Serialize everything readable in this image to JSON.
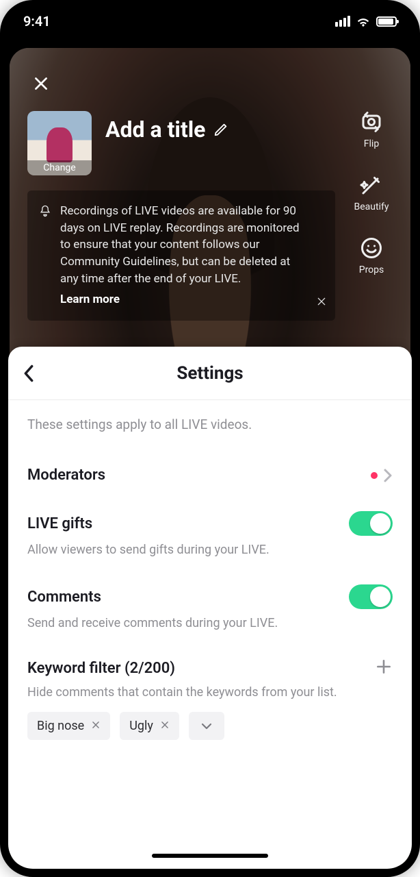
{
  "status": {
    "time": "9:41"
  },
  "camera": {
    "thumb_label": "Change",
    "title_placeholder": "Add a title",
    "info_text": "Recordings of LIVE videos are available for 90 days on LIVE replay. Recordings are monitored to ensure that your content follows our Community Guidelines, but can be deleted at any time after the end of your LIVE.",
    "info_learn_more": "Learn more",
    "tools": {
      "flip": "Flip",
      "beautify": "Beautify",
      "props": "Props"
    }
  },
  "sheet": {
    "title": "Settings",
    "hint": "These settings apply to all LIVE videos.",
    "moderators": {
      "label": "Moderators"
    },
    "gifts": {
      "label": "LIVE gifts",
      "desc": "Allow viewers to send gifts during your LIVE.",
      "on": true
    },
    "comments": {
      "label": "Comments",
      "desc": "Send and receive comments during your LIVE.",
      "on": true
    },
    "keyword_filter": {
      "label": "Keyword filter (2/200)",
      "desc": "Hide comments that contain the keywords from your list.",
      "chips": [
        "Big nose",
        "Ugly"
      ]
    }
  }
}
